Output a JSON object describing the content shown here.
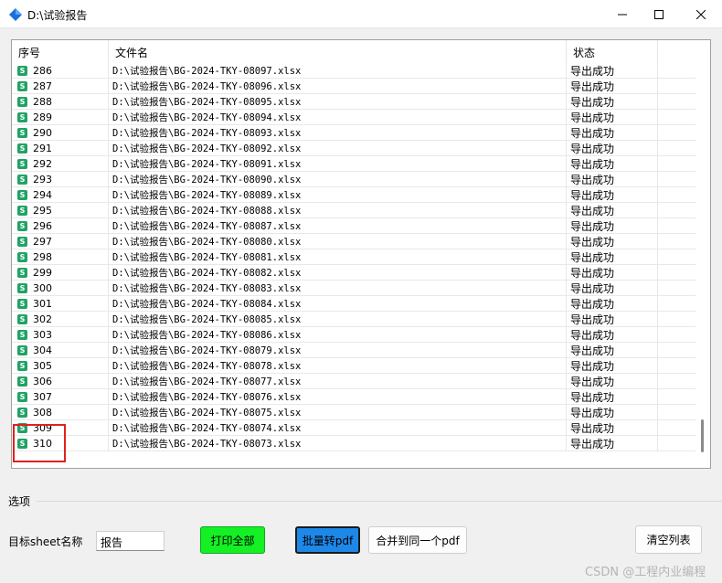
{
  "window": {
    "title": "D:\\试验报告",
    "icon": "app-icon",
    "minimize_glyph": "—",
    "maximize_glyph": "☐",
    "close_glyph": "✕"
  },
  "table": {
    "headers": [
      "序号",
      "文件名",
      "状态"
    ],
    "rows": [
      {
        "num": "286",
        "file": "D:\\试验报告\\BG-2024-TKY-08097.xlsx",
        "status": "导出成功"
      },
      {
        "num": "287",
        "file": "D:\\试验报告\\BG-2024-TKY-08096.xlsx",
        "status": "导出成功"
      },
      {
        "num": "288",
        "file": "D:\\试验报告\\BG-2024-TKY-08095.xlsx",
        "status": "导出成功"
      },
      {
        "num": "289",
        "file": "D:\\试验报告\\BG-2024-TKY-08094.xlsx",
        "status": "导出成功"
      },
      {
        "num": "290",
        "file": "D:\\试验报告\\BG-2024-TKY-08093.xlsx",
        "status": "导出成功"
      },
      {
        "num": "291",
        "file": "D:\\试验报告\\BG-2024-TKY-08092.xlsx",
        "status": "导出成功"
      },
      {
        "num": "292",
        "file": "D:\\试验报告\\BG-2024-TKY-08091.xlsx",
        "status": "导出成功"
      },
      {
        "num": "293",
        "file": "D:\\试验报告\\BG-2024-TKY-08090.xlsx",
        "status": "导出成功"
      },
      {
        "num": "294",
        "file": "D:\\试验报告\\BG-2024-TKY-08089.xlsx",
        "status": "导出成功"
      },
      {
        "num": "295",
        "file": "D:\\试验报告\\BG-2024-TKY-08088.xlsx",
        "status": "导出成功"
      },
      {
        "num": "296",
        "file": "D:\\试验报告\\BG-2024-TKY-08087.xlsx",
        "status": "导出成功"
      },
      {
        "num": "297",
        "file": "D:\\试验报告\\BG-2024-TKY-08080.xlsx",
        "status": "导出成功"
      },
      {
        "num": "298",
        "file": "D:\\试验报告\\BG-2024-TKY-08081.xlsx",
        "status": "导出成功"
      },
      {
        "num": "299",
        "file": "D:\\试验报告\\BG-2024-TKY-08082.xlsx",
        "status": "导出成功"
      },
      {
        "num": "300",
        "file": "D:\\试验报告\\BG-2024-TKY-08083.xlsx",
        "status": "导出成功"
      },
      {
        "num": "301",
        "file": "D:\\试验报告\\BG-2024-TKY-08084.xlsx",
        "status": "导出成功"
      },
      {
        "num": "302",
        "file": "D:\\试验报告\\BG-2024-TKY-08085.xlsx",
        "status": "导出成功"
      },
      {
        "num": "303",
        "file": "D:\\试验报告\\BG-2024-TKY-08086.xlsx",
        "status": "导出成功"
      },
      {
        "num": "304",
        "file": "D:\\试验报告\\BG-2024-TKY-08079.xlsx",
        "status": "导出成功"
      },
      {
        "num": "305",
        "file": "D:\\试验报告\\BG-2024-TKY-08078.xlsx",
        "status": "导出成功"
      },
      {
        "num": "306",
        "file": "D:\\试验报告\\BG-2024-TKY-08077.xlsx",
        "status": "导出成功"
      },
      {
        "num": "307",
        "file": "D:\\试验报告\\BG-2024-TKY-08076.xlsx",
        "status": "导出成功"
      },
      {
        "num": "308",
        "file": "D:\\试验报告\\BG-2024-TKY-08075.xlsx",
        "status": "导出成功"
      },
      {
        "num": "309",
        "file": "D:\\试验报告\\BG-2024-TKY-08074.xlsx",
        "status": "导出成功"
      },
      {
        "num": "310",
        "file": "D:\\试验报告\\BG-2024-TKY-08073.xlsx",
        "status": "导出成功"
      }
    ],
    "row_icon": "excel-file-icon",
    "row_icon_glyph": "S"
  },
  "options": {
    "group_label": "选项",
    "sheet_label": "目标sheet名称",
    "sheet_value": "报告",
    "print_all_label": "打印全部",
    "batch_pdf_label": "批量转pdf",
    "merge_pdf_label": "合并到同一个pdf",
    "clear_list_label": "清空列表"
  },
  "watermark": "CSDN @工程内业编程",
  "colors": {
    "print_button": "#14f024",
    "batch_button": "#1e88e8",
    "excel_icon": "#21a366",
    "highlight": "#e02020"
  }
}
